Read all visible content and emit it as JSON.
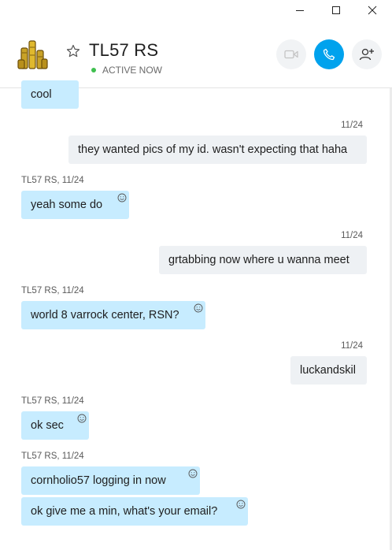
{
  "window": {
    "minimize_icon": "minimize-icon",
    "maximize_icon": "maximize-icon",
    "close_icon": "close-icon"
  },
  "header": {
    "contact_name": "TL57 RS",
    "status": "ACTIVE NOW",
    "status_color": "#3fbf4f",
    "accent_color": "#00a2ed"
  },
  "messages": [
    {
      "text": "cool"
    },
    {
      "time": "11/24",
      "text": "they wanted pics of my id. wasn't expecting that haha"
    },
    {
      "sender": "TL57 RS, 11/24",
      "text": "yeah some do"
    },
    {
      "time": "11/24",
      "text": "grtabbing now where u wanna meet"
    },
    {
      "sender": "TL57 RS, 11/24",
      "text": "world 8 varrock center, RSN?"
    },
    {
      "time": "11/24",
      "text": "luckandskil"
    },
    {
      "sender": "TL57 RS, 11/24",
      "text": "ok sec"
    },
    {
      "sender": "TL57 RS, 11/24",
      "text": "cornholio57 logging in now"
    },
    {
      "text": "ok give me a min, what's your email?"
    }
  ]
}
